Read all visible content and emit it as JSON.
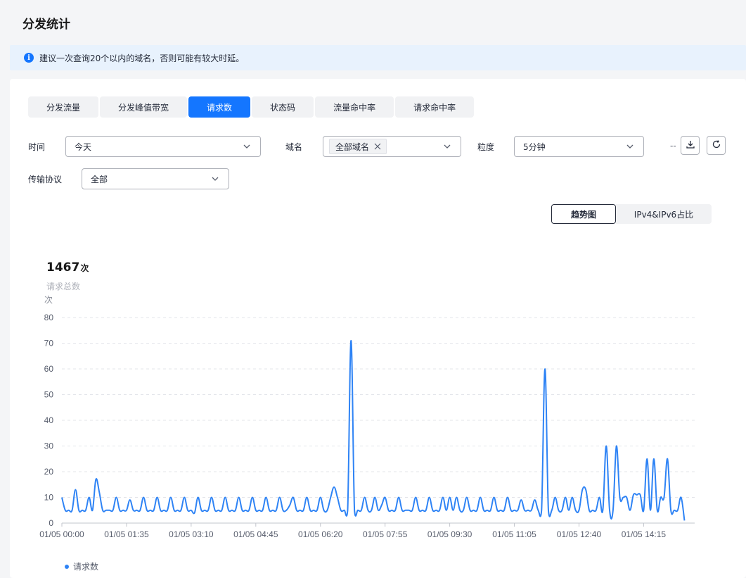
{
  "page_title": "分发统计",
  "notice": "建议一次查询20个以内的域名，否则可能有较大时延。",
  "tabs": [
    {
      "label": "分发流量",
      "active": false
    },
    {
      "label": "分发峰值带宽",
      "active": false
    },
    {
      "label": "请求数",
      "active": true
    },
    {
      "label": "状态码",
      "active": false
    },
    {
      "label": "流量命中率",
      "active": false
    },
    {
      "label": "请求命中率",
      "active": false
    }
  ],
  "filters": {
    "time_label": "时间",
    "time_value": "今天",
    "domain_label": "域名",
    "domain_tag": "全部域名",
    "granularity_label": "粒度",
    "granularity_value": "5分钟",
    "dash": "--",
    "protocol_label": "传输协议",
    "protocol_value": "全部"
  },
  "view_switch": {
    "trend": "趋势图",
    "ratio": "IPv4&IPv6占比"
  },
  "summary": {
    "total": "1467",
    "unit": "次",
    "label": "请求总数"
  },
  "colors": {
    "accent": "#1476ff",
    "series": "#2e83f5"
  },
  "chart_data": {
    "type": "line",
    "title": "",
    "xlabel": "",
    "ylabel": "次",
    "ylim": [
      0,
      80
    ],
    "y_ticks": [
      0,
      10,
      20,
      30,
      40,
      50,
      60,
      70,
      80
    ],
    "x_tick_labels": [
      "01/05 00:00",
      "01/05 01:35",
      "01/05 03:10",
      "01/05 04:45",
      "01/05 06:20",
      "01/05 07:55",
      "01/05 09:30",
      "01/05 11:05",
      "01/05 12:40",
      "01/05 14:15"
    ],
    "x_interval_minutes": 5,
    "x_start": "01/05 00:00",
    "grid": true,
    "legend_position": "bottom-left",
    "series": [
      {
        "name": "请求数",
        "values": [
          10,
          5,
          5,
          5,
          13,
          5,
          5,
          5,
          10,
          5,
          17,
          12,
          5,
          5,
          5,
          5,
          10,
          5,
          5,
          5,
          9,
          5,
          5,
          5,
          10,
          5,
          5,
          5,
          10,
          5,
          5,
          5,
          10,
          5,
          5,
          5,
          10,
          5,
          5,
          4,
          10,
          5,
          5,
          5,
          10,
          5,
          5,
          5,
          10,
          5,
          5,
          5,
          10,
          5,
          5,
          5,
          10,
          5,
          5,
          5,
          10,
          5,
          5,
          5,
          10,
          5,
          5,
          7,
          10,
          5,
          5,
          5,
          10,
          5,
          5,
          5,
          10,
          5,
          5,
          10,
          14,
          10,
          5,
          5,
          5,
          71,
          5,
          5,
          5,
          10,
          5,
          5,
          10,
          5,
          7,
          10,
          5,
          5,
          5,
          10,
          5,
          5,
          5,
          5,
          10,
          5,
          5,
          5,
          10,
          5,
          5,
          5,
          10,
          5,
          10,
          5,
          10,
          5,
          5,
          10,
          5,
          5,
          5,
          10,
          5,
          5,
          5,
          10,
          5,
          5,
          5,
          10,
          5,
          5,
          5,
          9,
          5,
          5,
          5,
          9,
          5,
          5,
          60,
          5,
          5,
          10,
          5,
          5,
          10,
          5,
          10,
          5,
          5,
          13,
          13,
          5,
          5,
          5,
          10,
          5,
          30,
          5,
          5,
          30,
          10,
          10,
          10,
          5,
          11,
          11,
          11,
          5,
          25,
          5,
          25,
          5,
          10,
          10,
          25,
          5,
          5,
          5,
          10,
          1
        ]
      }
    ]
  }
}
